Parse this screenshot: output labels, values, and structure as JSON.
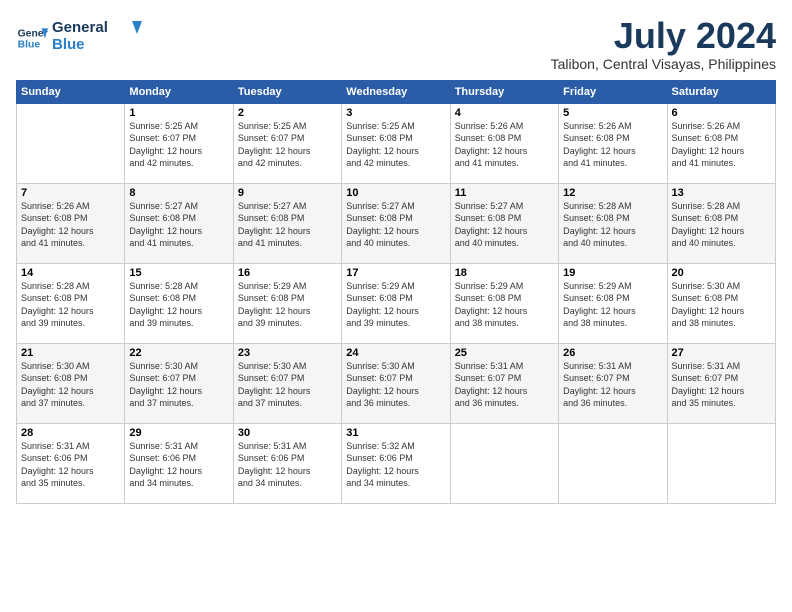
{
  "logo": {
    "line1": "General",
    "line2": "Blue"
  },
  "title": "July 2024",
  "location": "Talibon, Central Visayas, Philippines",
  "days_of_week": [
    "Sunday",
    "Monday",
    "Tuesday",
    "Wednesday",
    "Thursday",
    "Friday",
    "Saturday"
  ],
  "weeks": [
    [
      {
        "day": "",
        "info": ""
      },
      {
        "day": "1",
        "info": "Sunrise: 5:25 AM\nSunset: 6:07 PM\nDaylight: 12 hours\nand 42 minutes."
      },
      {
        "day": "2",
        "info": "Sunrise: 5:25 AM\nSunset: 6:07 PM\nDaylight: 12 hours\nand 42 minutes."
      },
      {
        "day": "3",
        "info": "Sunrise: 5:25 AM\nSunset: 6:08 PM\nDaylight: 12 hours\nand 42 minutes."
      },
      {
        "day": "4",
        "info": "Sunrise: 5:26 AM\nSunset: 6:08 PM\nDaylight: 12 hours\nand 41 minutes."
      },
      {
        "day": "5",
        "info": "Sunrise: 5:26 AM\nSunset: 6:08 PM\nDaylight: 12 hours\nand 41 minutes."
      },
      {
        "day": "6",
        "info": "Sunrise: 5:26 AM\nSunset: 6:08 PM\nDaylight: 12 hours\nand 41 minutes."
      }
    ],
    [
      {
        "day": "7",
        "info": "Sunrise: 5:26 AM\nSunset: 6:08 PM\nDaylight: 12 hours\nand 41 minutes."
      },
      {
        "day": "8",
        "info": "Sunrise: 5:27 AM\nSunset: 6:08 PM\nDaylight: 12 hours\nand 41 minutes."
      },
      {
        "day": "9",
        "info": "Sunrise: 5:27 AM\nSunset: 6:08 PM\nDaylight: 12 hours\nand 41 minutes."
      },
      {
        "day": "10",
        "info": "Sunrise: 5:27 AM\nSunset: 6:08 PM\nDaylight: 12 hours\nand 40 minutes."
      },
      {
        "day": "11",
        "info": "Sunrise: 5:27 AM\nSunset: 6:08 PM\nDaylight: 12 hours\nand 40 minutes."
      },
      {
        "day": "12",
        "info": "Sunrise: 5:28 AM\nSunset: 6:08 PM\nDaylight: 12 hours\nand 40 minutes."
      },
      {
        "day": "13",
        "info": "Sunrise: 5:28 AM\nSunset: 6:08 PM\nDaylight: 12 hours\nand 40 minutes."
      }
    ],
    [
      {
        "day": "14",
        "info": "Sunrise: 5:28 AM\nSunset: 6:08 PM\nDaylight: 12 hours\nand 39 minutes."
      },
      {
        "day": "15",
        "info": "Sunrise: 5:28 AM\nSunset: 6:08 PM\nDaylight: 12 hours\nand 39 minutes."
      },
      {
        "day": "16",
        "info": "Sunrise: 5:29 AM\nSunset: 6:08 PM\nDaylight: 12 hours\nand 39 minutes."
      },
      {
        "day": "17",
        "info": "Sunrise: 5:29 AM\nSunset: 6:08 PM\nDaylight: 12 hours\nand 39 minutes."
      },
      {
        "day": "18",
        "info": "Sunrise: 5:29 AM\nSunset: 6:08 PM\nDaylight: 12 hours\nand 38 minutes."
      },
      {
        "day": "19",
        "info": "Sunrise: 5:29 AM\nSunset: 6:08 PM\nDaylight: 12 hours\nand 38 minutes."
      },
      {
        "day": "20",
        "info": "Sunrise: 5:30 AM\nSunset: 6:08 PM\nDaylight: 12 hours\nand 38 minutes."
      }
    ],
    [
      {
        "day": "21",
        "info": "Sunrise: 5:30 AM\nSunset: 6:08 PM\nDaylight: 12 hours\nand 37 minutes."
      },
      {
        "day": "22",
        "info": "Sunrise: 5:30 AM\nSunset: 6:07 PM\nDaylight: 12 hours\nand 37 minutes."
      },
      {
        "day": "23",
        "info": "Sunrise: 5:30 AM\nSunset: 6:07 PM\nDaylight: 12 hours\nand 37 minutes."
      },
      {
        "day": "24",
        "info": "Sunrise: 5:30 AM\nSunset: 6:07 PM\nDaylight: 12 hours\nand 36 minutes."
      },
      {
        "day": "25",
        "info": "Sunrise: 5:31 AM\nSunset: 6:07 PM\nDaylight: 12 hours\nand 36 minutes."
      },
      {
        "day": "26",
        "info": "Sunrise: 5:31 AM\nSunset: 6:07 PM\nDaylight: 12 hours\nand 36 minutes."
      },
      {
        "day": "27",
        "info": "Sunrise: 5:31 AM\nSunset: 6:07 PM\nDaylight: 12 hours\nand 35 minutes."
      }
    ],
    [
      {
        "day": "28",
        "info": "Sunrise: 5:31 AM\nSunset: 6:06 PM\nDaylight: 12 hours\nand 35 minutes."
      },
      {
        "day": "29",
        "info": "Sunrise: 5:31 AM\nSunset: 6:06 PM\nDaylight: 12 hours\nand 34 minutes."
      },
      {
        "day": "30",
        "info": "Sunrise: 5:31 AM\nSunset: 6:06 PM\nDaylight: 12 hours\nand 34 minutes."
      },
      {
        "day": "31",
        "info": "Sunrise: 5:32 AM\nSunset: 6:06 PM\nDaylight: 12 hours\nand 34 minutes."
      },
      {
        "day": "",
        "info": ""
      },
      {
        "day": "",
        "info": ""
      },
      {
        "day": "",
        "info": ""
      }
    ]
  ]
}
